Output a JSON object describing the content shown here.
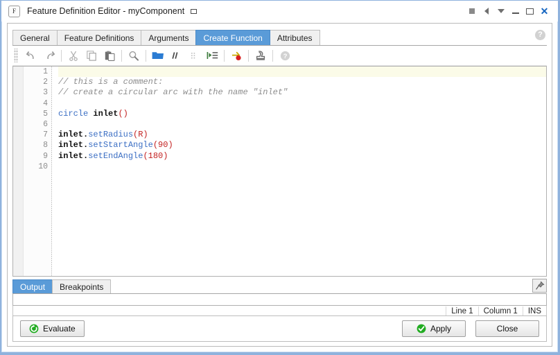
{
  "window": {
    "app_badge": "F",
    "title": "Feature Definition Editor - myComponent",
    "controls": [
      {
        "name": "stop",
        "label": ""
      },
      {
        "name": "previous",
        "label": ""
      },
      {
        "name": "dropdown",
        "label": ""
      },
      {
        "name": "minimize",
        "label": ""
      },
      {
        "name": "maximize",
        "label": ""
      },
      {
        "name": "close",
        "label": "✕"
      }
    ]
  },
  "tabs": [
    {
      "label": "General",
      "active": false
    },
    {
      "label": "Feature Definitions",
      "active": false
    },
    {
      "label": "Arguments",
      "active": false
    },
    {
      "label": "Create Function",
      "active": true
    },
    {
      "label": "Attributes",
      "active": false
    }
  ],
  "help": {
    "label": "?",
    "icon": "help-icon"
  },
  "toolbar": {
    "items": [
      {
        "icon": "undo-icon",
        "label": "Undo"
      },
      {
        "icon": "redo-icon",
        "label": "Redo"
      },
      {
        "icon": "cut-icon",
        "label": "Cut"
      },
      {
        "icon": "copy-icon",
        "label": "Copy"
      },
      {
        "icon": "paste-icon",
        "label": "Paste"
      },
      {
        "icon": "search-icon",
        "label": "Find"
      },
      {
        "icon": "folder-icon",
        "label": "Open"
      },
      {
        "icon": "comment-icon",
        "label": "Comment"
      },
      {
        "icon": "uncomment-icon",
        "label": "Uncomment"
      },
      {
        "icon": "indent-icon",
        "label": "Indent"
      },
      {
        "icon": "breakpoint-icon",
        "label": "Toggle Breakpoint"
      },
      {
        "icon": "stamp-icon",
        "label": "Insert"
      },
      {
        "icon": "help-icon",
        "label": "Help"
      }
    ]
  },
  "editor": {
    "line_numbers": [
      "1",
      "2",
      "3",
      "4",
      "5",
      "6",
      "7",
      "8",
      "9",
      "10"
    ],
    "current_line": 1,
    "lines": [
      {
        "num": 1,
        "tokens": []
      },
      {
        "num": 2,
        "tokens": [
          {
            "t": "comment",
            "s": "// this is a comment:"
          }
        ]
      },
      {
        "num": 3,
        "tokens": [
          {
            "t": "comment",
            "s": "// create a circular arc with the name \"inlet\""
          }
        ]
      },
      {
        "num": 4,
        "tokens": []
      },
      {
        "num": 5,
        "tokens": [
          {
            "t": "kw",
            "s": "circle"
          },
          {
            "t": "plain",
            "s": " "
          },
          {
            "t": "id",
            "s": "inlet"
          },
          {
            "t": "punc",
            "s": "()"
          }
        ]
      },
      {
        "num": 6,
        "tokens": []
      },
      {
        "num": 7,
        "tokens": [
          {
            "t": "id",
            "s": "inlet."
          },
          {
            "t": "fn",
            "s": "setRadius"
          },
          {
            "t": "punc",
            "s": "(R)"
          }
        ]
      },
      {
        "num": 8,
        "tokens": [
          {
            "t": "id",
            "s": "inlet."
          },
          {
            "t": "fn",
            "s": "setStartAngle"
          },
          {
            "t": "punc",
            "s": "(90)"
          }
        ]
      },
      {
        "num": 9,
        "tokens": [
          {
            "t": "id",
            "s": "inlet."
          },
          {
            "t": "fn",
            "s": "setEndAngle"
          },
          {
            "t": "punc",
            "s": "(180)"
          }
        ]
      },
      {
        "num": 10,
        "tokens": []
      }
    ]
  },
  "output": {
    "tabs": [
      {
        "label": "Output",
        "active": true
      },
      {
        "label": "Breakpoints",
        "active": false
      }
    ],
    "pin": {
      "icon": "pin-icon",
      "label": ""
    },
    "body_text": ""
  },
  "status": {
    "line": "Line 1",
    "column": "Column 1",
    "mode": "INS"
  },
  "buttons": {
    "evaluate": "Evaluate",
    "apply": "Apply",
    "close": "Close"
  },
  "colors": {
    "accent": "#5a9bd8",
    "frame": "#8fb2dd",
    "keyword": "#3c6fc4",
    "punctuation": "#c32020",
    "comment": "#8d8d8d",
    "success": "#22ac22",
    "current_line_highlight": "#fbfbe8"
  }
}
